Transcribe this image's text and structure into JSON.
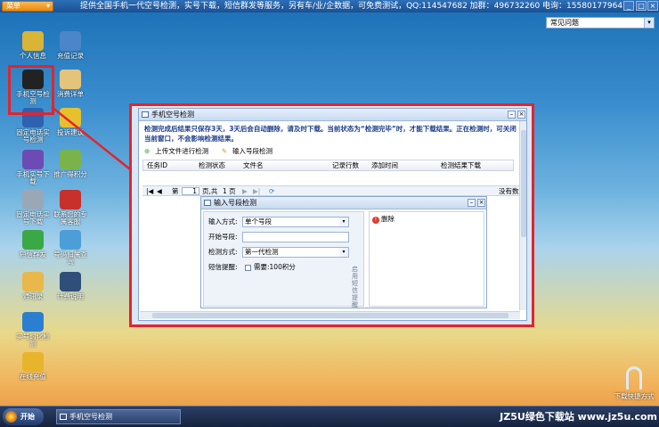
{
  "topbar": {
    "menu": "菜单",
    "info": "提供全国手机一代空号检测，实号下载，短信群发等服务，另有车/业/企数据，可免费测试，QQ:114547682 加群：496732260 电询：15580177964"
  },
  "faq": "常见问题",
  "desktop": [
    {
      "label": "个人信息",
      "icon": "key-icon",
      "color": "#d9b437"
    },
    {
      "label": "充值记录",
      "icon": "card-icon",
      "color": "#4a86c8"
    },
    {
      "label": "手机空号检测",
      "icon": "phone-icon",
      "color": "#222222"
    },
    {
      "label": "消费详单",
      "icon": "clipboard-icon",
      "color": "#e4c47a"
    },
    {
      "label": "固定电话实号检测",
      "icon": "telephone-icon",
      "color": "#2d62b0"
    },
    {
      "label": "投诉建议",
      "icon": "envelope-icon",
      "color": "#e7c02d"
    },
    {
      "label": "手机实号下载",
      "icon": "mobile-icon",
      "color": "#6d4bb4"
    },
    {
      "label": "推广得积分",
      "icon": "promote-icon",
      "color": "#7ab34a"
    },
    {
      "label": "固定电话实号下载",
      "icon": "fax-icon",
      "color": "#9aa7b7"
    },
    {
      "label": "联系您的专属客服",
      "icon": "handset-icon",
      "color": "#c8302b"
    },
    {
      "label": "短信群发",
      "icon": "sms-icon",
      "color": "#3aa844"
    },
    {
      "label": "号码归属查询",
      "icon": "globe-icon",
      "color": "#4c9ed8"
    },
    {
      "label": "通讯录",
      "icon": "book-icon",
      "color": "#e9b84a"
    },
    {
      "label": "计费说明",
      "icon": "monitor-icon",
      "color": "#2f4f7a"
    },
    {
      "label": "实号时化检测",
      "icon": "magnifier-icon",
      "color": "#2b7fd1"
    },
    {
      "label": "在线充值",
      "icon": "coins-icon",
      "color": "#e6b52c"
    }
  ],
  "window": {
    "title": "手机空号检测",
    "notice": "检测完成后结果只保存3天，3天后会自动删除，请及时下载。当前状态为“检测完毕”时，才能下载结果。正在检测时，可关闭当前窗口，不会影响检测结果。",
    "toolbar": [
      "上传文件进行检测",
      "输入号段检测"
    ],
    "columns": [
      "任务ID",
      "检测状态",
      "文件名",
      "记录行数",
      "添加时间",
      "检测结果下载"
    ],
    "pager": {
      "page_label": "第",
      "page": "1",
      "of": "页,共",
      "total": "1 页",
      "right": "没有数"
    }
  },
  "dialog": {
    "title": "输入号段检测",
    "mode_label": "输入方式:",
    "mode_value": "单个号段",
    "start_label": "开始号段:",
    "start_value": "",
    "check_label": "检测方式:",
    "check_value": "第一代检测",
    "sms_label": "短信提醒:",
    "sms_value": "需要:100积分",
    "vertical": "启用短信提醒",
    "delete": "删除"
  },
  "taskbar": {
    "start": "开始",
    "task": "手机空号检测",
    "watermark": "JZ5U绿色下载站 www.jz5u.com"
  },
  "download_mode": "下载快捷方式"
}
